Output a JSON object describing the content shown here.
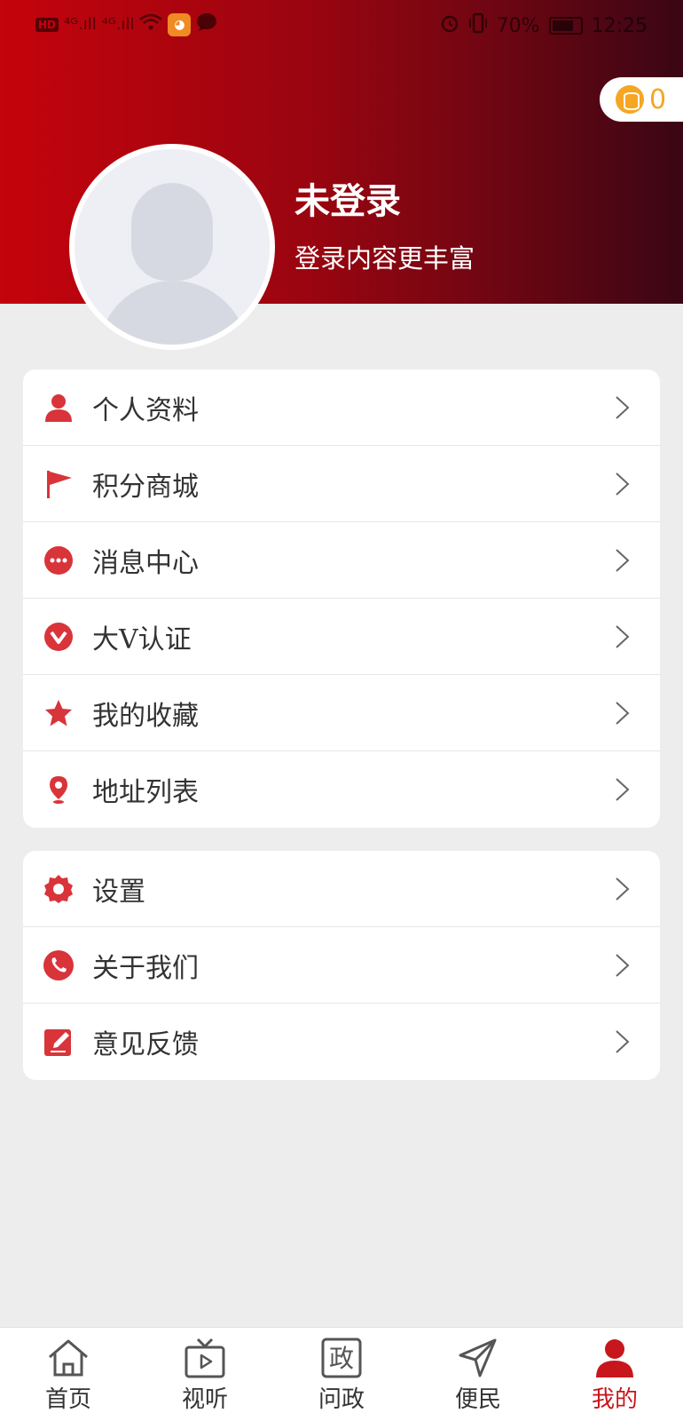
{
  "status_bar": {
    "left_badge": "HD",
    "signal_1": "⁴ᴳ.ıll",
    "signal_2": "⁴ᴳ.ıll",
    "battery": "70%",
    "time": "12:25"
  },
  "header": {
    "coin_count": "0",
    "user_name": "未登录",
    "user_subtitle": "登录内容更丰富"
  },
  "menu_group_1": [
    {
      "label": "个人资料",
      "icon": "user-icon"
    },
    {
      "label": "积分商城",
      "icon": "flag-icon"
    },
    {
      "label": "消息中心",
      "icon": "chat-bubble-icon"
    },
    {
      "label": "大V认证",
      "icon": "v-badge-icon"
    },
    {
      "label": "我的收藏",
      "icon": "star-icon"
    },
    {
      "label": "地址列表",
      "icon": "location-pin-icon"
    }
  ],
  "menu_group_2": [
    {
      "label": "设置",
      "icon": "gear-icon"
    },
    {
      "label": "关于我们",
      "icon": "phone-icon"
    },
    {
      "label": "意见反馈",
      "icon": "edit-icon"
    }
  ],
  "tabbar": [
    {
      "label": "首页",
      "icon": "home-icon",
      "active": false
    },
    {
      "label": "视听",
      "icon": "tv-icon",
      "active": false
    },
    {
      "label": "问政",
      "icon": "zheng-icon",
      "glyph": "政",
      "active": false
    },
    {
      "label": "便民",
      "icon": "send-icon",
      "active": false
    },
    {
      "label": "我的",
      "icon": "profile-icon",
      "active": true
    }
  ],
  "colors": {
    "brand_red": "#c8161d",
    "coin_gold": "#f5a623",
    "header_gradient_start": "#c4030c",
    "header_gradient_end": "#3a0614"
  }
}
